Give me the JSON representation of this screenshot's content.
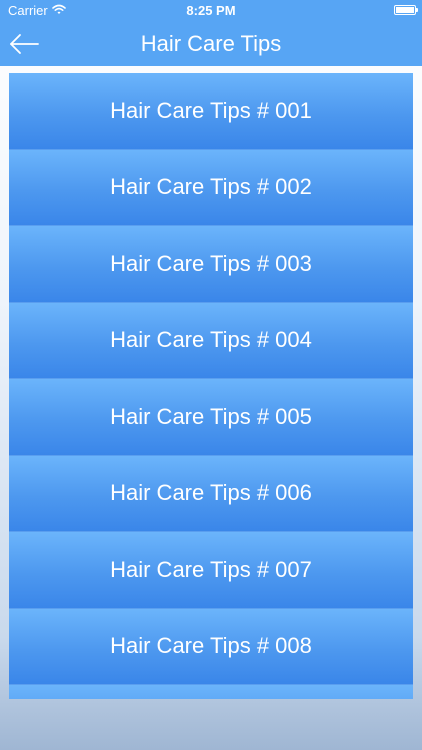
{
  "status_bar": {
    "carrier": "Carrier",
    "time": "8:25 PM",
    "wifi_icon": "wifi-icon",
    "battery_icon": "battery-icon"
  },
  "nav": {
    "title": "Hair Care Tips",
    "back_icon": "arrow-left-icon"
  },
  "colors": {
    "accent": "#57a5f4",
    "item_top": "#6bb4fb",
    "item_bottom": "#3a86e9"
  },
  "list": {
    "items": [
      {
        "label": "Hair Care Tips # 001"
      },
      {
        "label": "Hair Care Tips # 002"
      },
      {
        "label": "Hair Care Tips # 003"
      },
      {
        "label": "Hair Care Tips # 004"
      },
      {
        "label": "Hair Care Tips # 005"
      },
      {
        "label": "Hair Care Tips # 006"
      },
      {
        "label": "Hair Care Tips # 007"
      },
      {
        "label": "Hair Care Tips # 008"
      },
      {
        "label": ""
      }
    ]
  }
}
